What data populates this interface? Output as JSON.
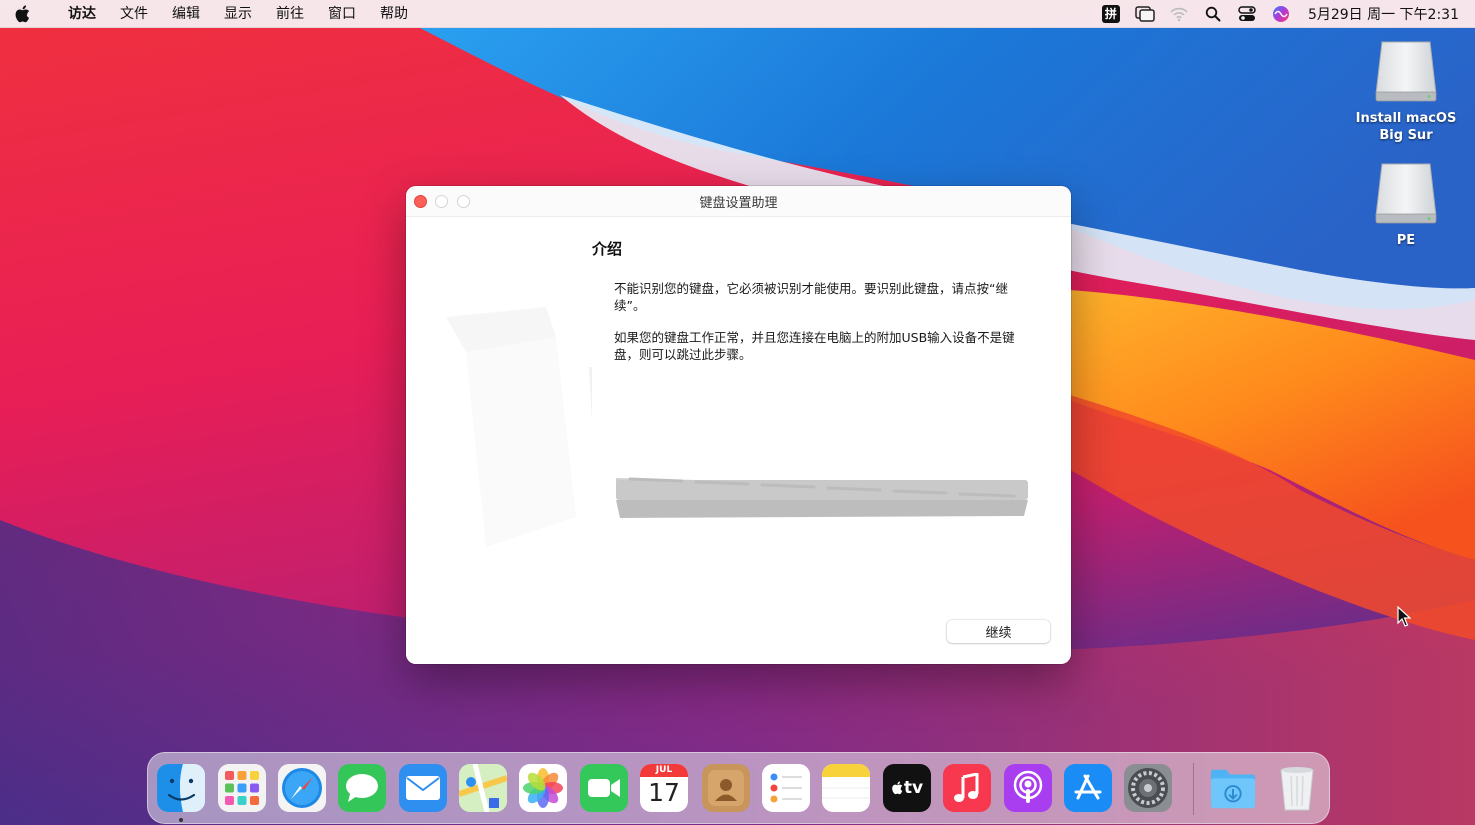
{
  "menubar": {
    "apple_icon": "apple-logo-icon",
    "items": [
      "访达",
      "文件",
      "编辑",
      "显示",
      "前往",
      "窗口",
      "帮助"
    ],
    "ime_label": "拼",
    "status_icons": [
      "input-method-icon",
      "screen-mirroring-icon",
      "wifi-icon",
      "search-icon",
      "control-center-icon",
      "siri-icon"
    ],
    "clock": "5月29日 周一 下午2:31"
  },
  "desktop": {
    "icons": [
      {
        "label": "Install macOS Big Sur",
        "icon": "disk-drive-icon"
      },
      {
        "label": "PE",
        "icon": "disk-drive-icon"
      }
    ]
  },
  "window": {
    "title": "键盘设置助理",
    "section_title": "介绍",
    "paragraph1": "不能识别您的键盘，它必须被识别才能使用。要识别此键盘，请点按“继续”。",
    "paragraph2": "如果您的键盘工作正常，并且您连接在电脑上的附加USB输入设备不是键盘，则可以跳过此步骤。",
    "continue_label": "继续"
  },
  "dock": {
    "apps": [
      {
        "name": "finder",
        "running": true
      },
      {
        "name": "launchpad"
      },
      {
        "name": "safari"
      },
      {
        "name": "messages"
      },
      {
        "name": "mail"
      },
      {
        "name": "maps"
      },
      {
        "name": "photos"
      },
      {
        "name": "facetime"
      },
      {
        "name": "calendar",
        "month": "JUL",
        "day": "17"
      },
      {
        "name": "contacts"
      },
      {
        "name": "reminders"
      },
      {
        "name": "notes"
      },
      {
        "name": "apple-tv",
        "label": "tv"
      },
      {
        "name": "music"
      },
      {
        "name": "podcasts"
      },
      {
        "name": "app-store"
      },
      {
        "name": "system-preferences"
      },
      {
        "name": "downloads-folder"
      },
      {
        "name": "trash"
      }
    ]
  },
  "colors": {
    "close_button": "#fe5f57",
    "menubar_bg": "#f6f6f8"
  }
}
